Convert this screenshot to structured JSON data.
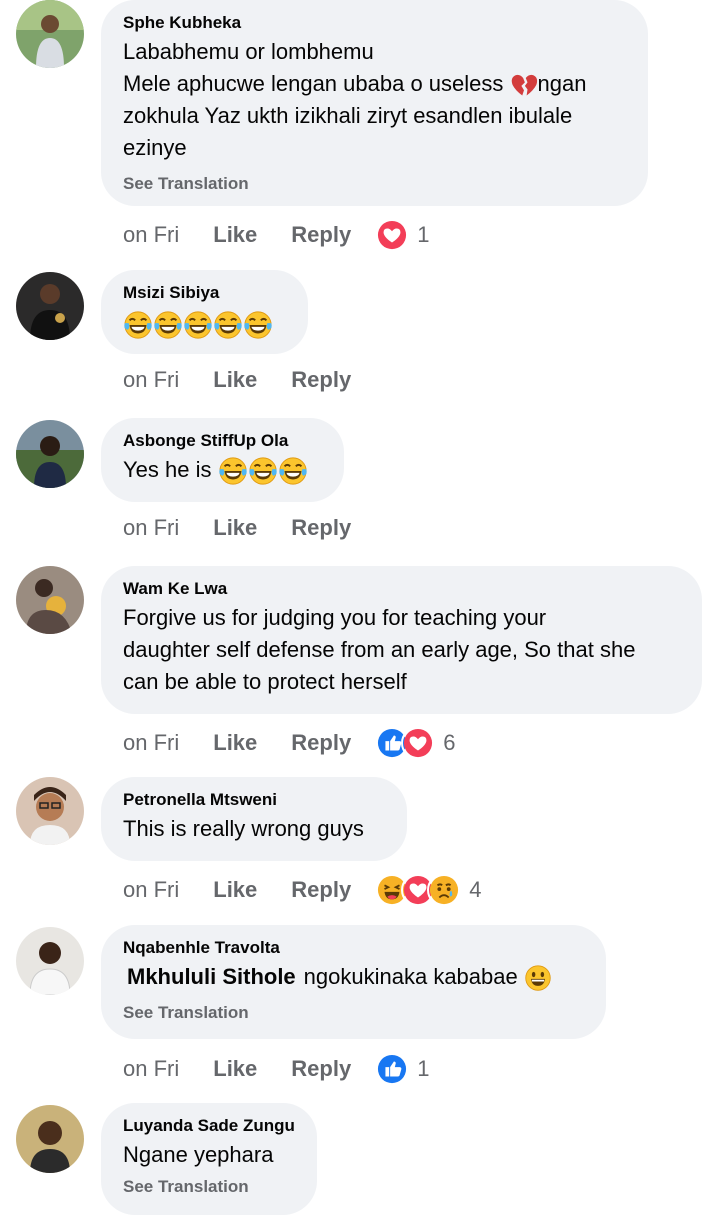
{
  "comments": [
    {
      "author": "Sphe Kubheka",
      "lines": [
        "Lababhemu or lombhemu",
        "Mele aphucwe lengan ubaba o useless",
        "ngan",
        "zokhula Yaz ukth izikhali ziryt esandlen ibulale",
        "ezinye"
      ],
      "see_translation": "See Translation",
      "time": "on Fri",
      "like": "Like",
      "reply": "Reply",
      "reaction_count": "1",
      "reactions": [
        "love"
      ]
    },
    {
      "author": "Msizi Sibiya",
      "emoji_count": 5,
      "time": "on Fri",
      "like": "Like",
      "reply": "Reply"
    },
    {
      "author": "Asbonge StiffUp Ola",
      "text": "Yes he is",
      "time": "on Fri",
      "like": "Like",
      "reply": "Reply"
    },
    {
      "author": "Wam Ke Lwa",
      "lines": [
        "Forgive us for judging you for teaching your",
        "daughter self defense from an early age, So that she",
        "can be able to protect herself"
      ],
      "time": "on Fri",
      "like": "Like",
      "reply": "Reply",
      "reaction_count": "6",
      "reactions": [
        "like",
        "love"
      ]
    },
    {
      "author": "Petronella Mtsweni",
      "text": "This is really wrong guys",
      "time": "on Fri",
      "like": "Like",
      "reply": "Reply",
      "reaction_count": "4",
      "reactions": [
        "haha",
        "love",
        "sad"
      ]
    },
    {
      "author": "Nqabenhle Travolta",
      "mention": "Mkhululi Sithole",
      "text": "ngokukinaka kababae",
      "see_translation": "See Translation",
      "time": "on Fri",
      "like": "Like",
      "reply": "Reply",
      "reaction_count": "1",
      "reactions": [
        "like"
      ]
    },
    {
      "author": "Luyanda Sade Zungu",
      "text": "Ngane yephara",
      "see_translation": "See Translation"
    }
  ],
  "colors": {
    "like": "#1877f2",
    "love": "#f33e58",
    "haha": "#f7b125",
    "bubble": "#f0f2f5",
    "meta": "#65676b"
  },
  "icons": [
    "laughing-tears-emoji",
    "broken-heart-emoji",
    "grinning-emoji",
    "like-reaction-icon",
    "love-reaction-icon",
    "haha-reaction-icon",
    "sad-reaction-icon"
  ]
}
